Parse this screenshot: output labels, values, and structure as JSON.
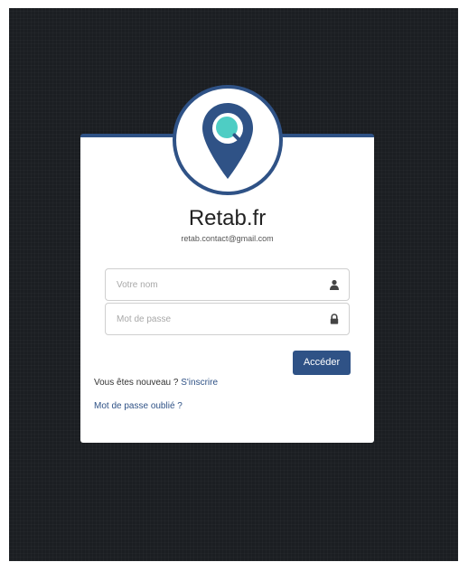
{
  "brand": {
    "title": "Retab.fr",
    "email": "retab.contact@gmail.com"
  },
  "form": {
    "name_placeholder": "Votre nom",
    "password_placeholder": "Mot de passe",
    "name_icon": "user-icon",
    "password_icon": "lock-icon",
    "submit_label": "Accéder"
  },
  "links": {
    "new_prompt": "Vous êtes nouveau ?",
    "register": "S'inscrire",
    "forgot": "Mot de passe oublié ?"
  },
  "colors": {
    "accent": "#2f5286",
    "logo_fill": "#2f5286",
    "logo_lens": "#4ecdc4",
    "background": "#1b1e22"
  }
}
